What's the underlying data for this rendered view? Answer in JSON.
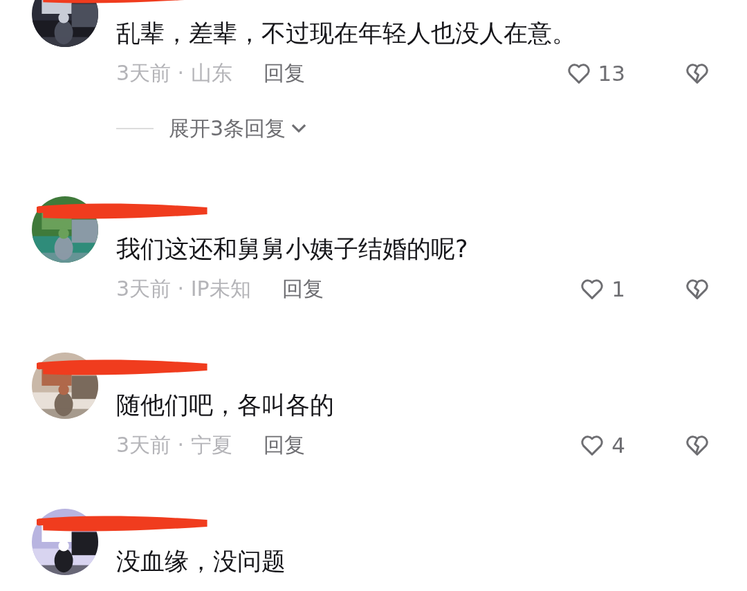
{
  "comments": [
    {
      "text": "乱辈，差辈，不过现在年轻人也没人在意。",
      "meta": "3天前 · 山东",
      "reply": "回复",
      "likes": "13",
      "expand": "展开3条回复"
    },
    {
      "text": "我们这还和舅舅小姨子结婚的呢?",
      "meta": "3天前 · IP未知",
      "reply": "回复",
      "likes": "1"
    },
    {
      "text": "随他们吧，各叫各的",
      "meta": "3天前 · 宁夏",
      "reply": "回复",
      "likes": "4"
    },
    {
      "text": "没血缘，没问题"
    }
  ]
}
